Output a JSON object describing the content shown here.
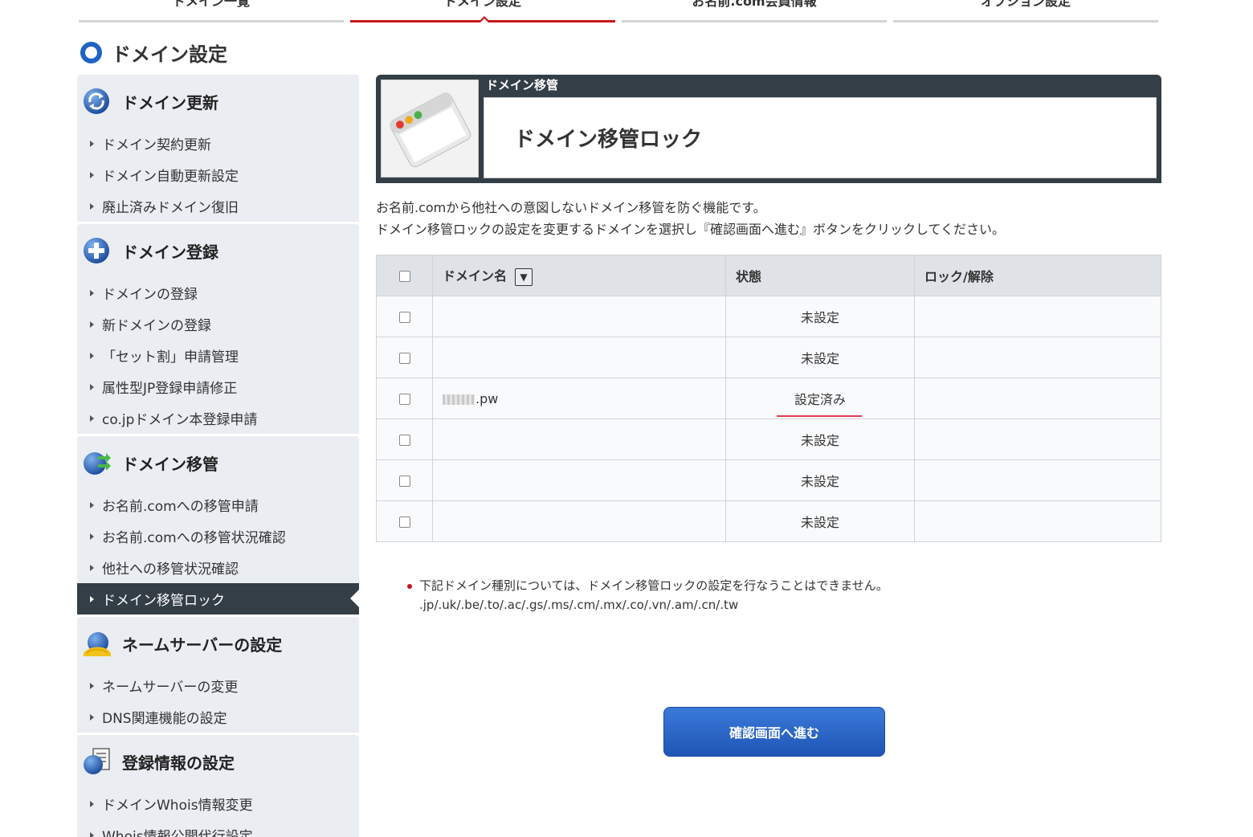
{
  "top_tabs": [
    {
      "label": "ドメイン一覧",
      "active": false
    },
    {
      "label": "ドメイン設定",
      "active": true
    },
    {
      "label": "お名前.com会員情報",
      "active": false
    },
    {
      "label": "オプション設定",
      "active": false
    }
  ],
  "page_title": "ドメイン設定",
  "sidebar": {
    "sections": [
      {
        "title": "ドメイン更新",
        "icon": "refresh-icon",
        "items": [
          "ドメイン契約更新",
          "ドメイン自動更新設定",
          "廃止済みドメイン復旧"
        ]
      },
      {
        "title": "ドメイン登録",
        "icon": "plus-icon",
        "items": [
          "ドメインの登録",
          "新ドメインの登録",
          "「セット割」申請管理",
          "属性型JP登録申請修正",
          "co.jpドメイン本登録申請"
        ]
      },
      {
        "title": "ドメイン移管",
        "icon": "transfer-icon",
        "items": [
          "お名前.comへの移管申請",
          "お名前.comへの移管状況確認",
          "他社への移管状況確認",
          "ドメイン移管ロック"
        ],
        "active_index": 3
      },
      {
        "title": "ネームサーバーの設定",
        "icon": "nameserver-icon",
        "items": [
          "ネームサーバーの変更",
          "DNS関連機能の設定"
        ]
      },
      {
        "title": "登録情報の設定",
        "icon": "registration-info-icon",
        "items": [
          "ドメインWhois情報変更",
          "Whois情報公開代行設定"
        ]
      }
    ]
  },
  "panel": {
    "category": "ドメイン移管",
    "title": "ドメイン移管ロック",
    "icon": "window-icon"
  },
  "description": [
    "お名前.comから他社への意図しないドメイン移管を防ぐ機能です。",
    "ドメイン移管ロックの設定を変更するドメインを選択し『確認画面へ進む』ボタンをクリックしてください。"
  ],
  "table": {
    "headers": {
      "domain": "ドメイン名",
      "sort_glyph": "▼",
      "state": "状態",
      "lock": "ロック/解除"
    },
    "rows": [
      {
        "domain": "",
        "state": "未設定",
        "lock": ""
      },
      {
        "domain": "",
        "state": "未設定",
        "lock": ""
      },
      {
        "domain": ".pw",
        "state": "設定済み",
        "lock": "",
        "highlight": true
      },
      {
        "domain": "",
        "state": "未設定",
        "lock": ""
      },
      {
        "domain": "",
        "state": "未設定",
        "lock": ""
      },
      {
        "domain": "",
        "state": "未設定",
        "lock": ""
      }
    ]
  },
  "note": {
    "line1": "下記ドメイン種別については、ドメイン移管ロックの設定を行なうことはできません。",
    "line2": ".jp/.uk/.be/.to/.ac/.gs/.ms/.cm/.mx/.co/.vn/.am/.cn/.tw"
  },
  "confirm_button": "確認画面へ進む",
  "colors": {
    "accent_red": "#c8161d",
    "brand_blue": "#2763c8",
    "dark_panel": "#333e46",
    "sidebar_bg": "#eaedf2"
  }
}
